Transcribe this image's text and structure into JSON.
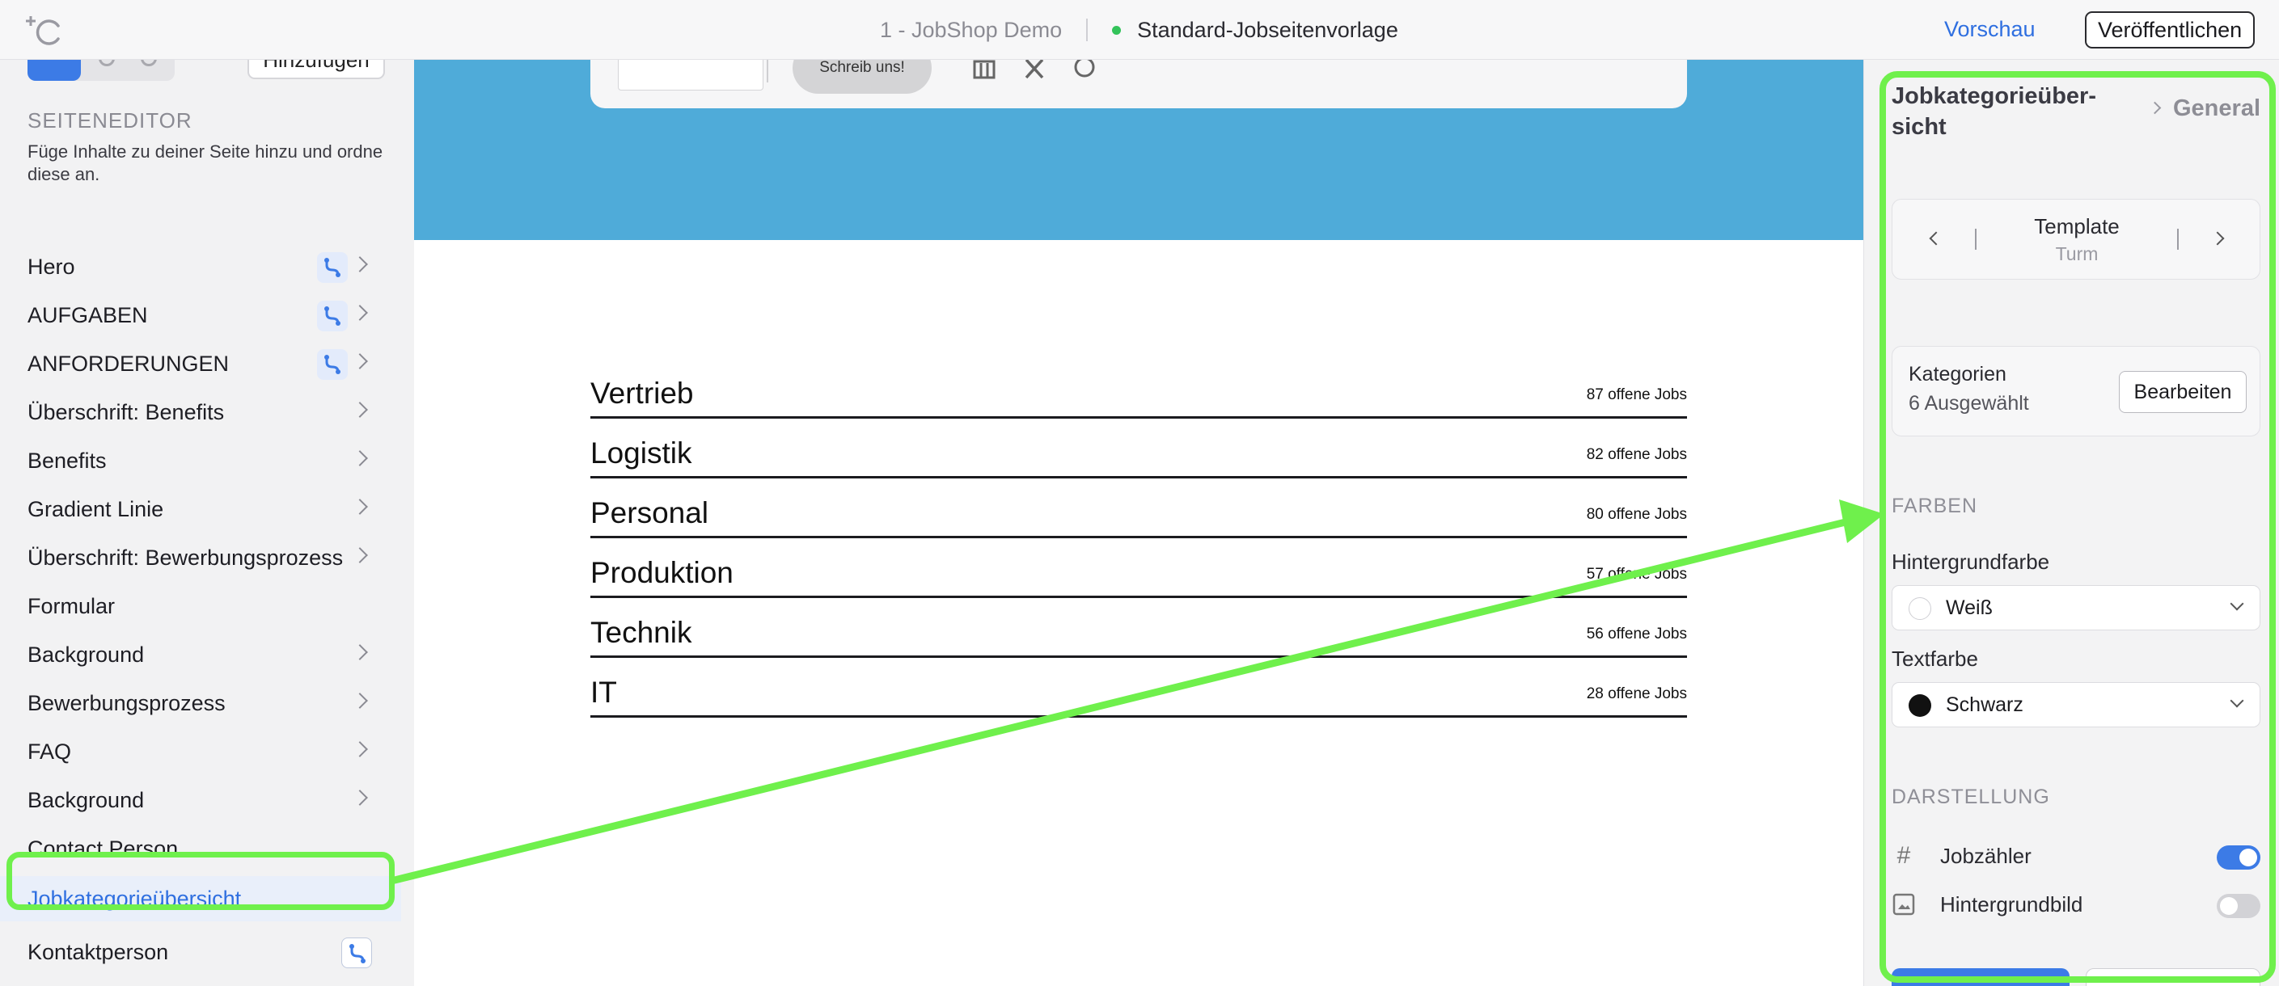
{
  "topbar": {
    "project_name": "1 - JobShop Demo",
    "template_name": "Standard-Jobseitenvorlage",
    "status_color": "#33c35a",
    "preview_label": "Vorschau",
    "publish_label": "Veröffentlichen"
  },
  "sidebar": {
    "add_label": "Hinzufügen",
    "section_title": "SEITENEDITOR",
    "section_description": "Füge Inhalte zu deiner Seite hinzu und ordne diese an.",
    "items": [
      {
        "label": "Hero",
        "badge": true,
        "chevron": true
      },
      {
        "label": "AUFGABEN",
        "badge": true,
        "chevron": true
      },
      {
        "label": "ANFORDERUNGEN",
        "badge": true,
        "chevron": true
      },
      {
        "label": "Überschrift: Benefits",
        "badge": false,
        "chevron": true
      },
      {
        "label": "Benefits",
        "badge": false,
        "chevron": true
      },
      {
        "label": "Gradient Linie",
        "badge": false,
        "chevron": true
      },
      {
        "label": "Überschrift: Bewerbungsprozess",
        "badge": false,
        "chevron": true
      },
      {
        "label": "Formular",
        "badge": false,
        "chevron": false
      },
      {
        "label": "Background",
        "badge": false,
        "chevron": true
      },
      {
        "label": "Bewerbungsprozess",
        "badge": false,
        "chevron": true
      },
      {
        "label": "FAQ",
        "badge": false,
        "chevron": true
      },
      {
        "label": "Background",
        "badge": false,
        "chevron": true
      },
      {
        "label": "Contact Person",
        "badge": false,
        "chevron": false
      },
      {
        "label": "Jobkategorieübersicht",
        "badge": false,
        "chevron": false,
        "active": true
      },
      {
        "label": "Kontaktperson",
        "badge": true,
        "chevron": false
      }
    ]
  },
  "canvas": {
    "hero_color": "#4fabd9",
    "hero_button_label": "Schreib uns!",
    "job_categories": [
      {
        "name": "Vertrieb",
        "count": "87 offene Jobs"
      },
      {
        "name": "Logistik",
        "count": "82 offene Jobs"
      },
      {
        "name": "Personal",
        "count": "80 offene Jobs"
      },
      {
        "name": "Produktion",
        "count": "57 offene Jobs"
      },
      {
        "name": "Technik",
        "count": "56 offene Jobs"
      },
      {
        "name": "IT",
        "count": "28 offene Jobs"
      }
    ]
  },
  "panel": {
    "title": "Jobkategorieüber-sicht",
    "breadcrumb": "General",
    "template": {
      "label": "Template",
      "value": "Turm"
    },
    "categories": {
      "label": "Kategorien",
      "value": "6 Ausgewählt",
      "edit_label": "Bearbeiten"
    },
    "colors_section": "FARBEN",
    "background_color": {
      "label": "Hintergrundfarbe",
      "value": "Weiß",
      "swatch": "#ffffff"
    },
    "text_color": {
      "label": "Textfarbe",
      "value": "Schwarz",
      "swatch": "#111111"
    },
    "display_section": "DARSTELLUNG",
    "toggles": [
      {
        "label": "Jobzähler",
        "icon": "hash-icon",
        "on": true
      },
      {
        "label": "Hintergrundbild",
        "icon": "image-icon",
        "on": false
      }
    ]
  },
  "annotation": {
    "color": "#6ff04c"
  }
}
